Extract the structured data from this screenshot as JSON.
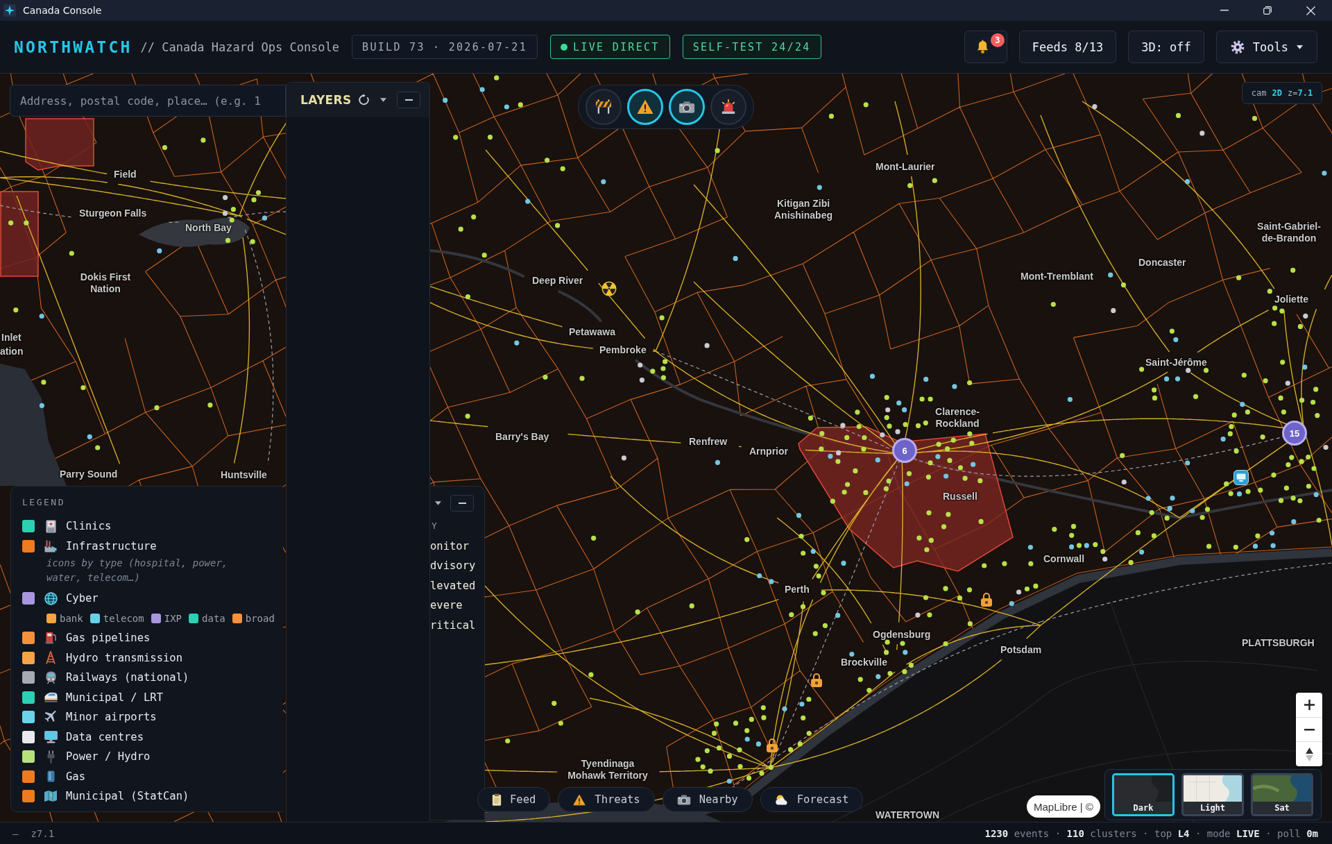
{
  "window": {
    "title": "Canada Console"
  },
  "header": {
    "brand": "NORTHWATCH",
    "subtitle": "// Canada Hazard Ops Console",
    "build": "BUILD 73 · 2026-07-21",
    "status_chips": [
      {
        "kind": "live",
        "label": "LIVE DIRECT"
      },
      {
        "kind": "test",
        "label": "SELF-TEST 24/24"
      }
    ],
    "notifications": {
      "badge": "3"
    },
    "buttons": [
      {
        "kind": "feeds",
        "label": "Feeds 8/13"
      },
      {
        "kind": "view",
        "label": "3D: off"
      },
      {
        "kind": "menu",
        "label": "Tools"
      }
    ]
  },
  "search": {
    "placeholder": "Address, postal code, place… (e.g. 1"
  },
  "layers_panel": {
    "title": "LAYERS"
  },
  "map_toolbar": [
    {
      "kind": "roadwork",
      "selected": false
    },
    {
      "kind": "hazard",
      "selected": true
    },
    {
      "kind": "camera",
      "selected": true
    },
    {
      "kind": "alert",
      "selected": false
    }
  ],
  "camera_status": {
    "label": "cam",
    "mode": "2D",
    "zoom_prefix": "z=",
    "zoom": "7.1"
  },
  "map": {
    "place_labels": [
      "Field",
      "Sturgeon Falls",
      "North Bay",
      "Dokis First Nation",
      "Inlet",
      "ation",
      "Parry Sound",
      "Huntsville",
      "Deep River",
      "Petawawa",
      "Pembroke",
      "Barry's Bay",
      "Renfrew",
      "Arnprior",
      "Mont-Laurier",
      "Kitigan Zibi Anishinabeg",
      "Saint-Gabriel-de-Brandon",
      "Doncaster",
      "Mont-Tremblant",
      "Joliette",
      "Saint-Jérôme",
      "Clarence-Rockland",
      "Russell",
      "Cornwall",
      "Perth",
      "Ogdensburg",
      "Brockville",
      "Potsdam",
      "PLATTSBURGH",
      "Tyendinaga Mohawk Territory",
      "WATERTOWN"
    ],
    "clusters": [
      {
        "count": "6"
      },
      {
        "count": "15"
      }
    ]
  },
  "legend": {
    "title": "LEGEND",
    "items": [
      {
        "kind": "layer",
        "label": "Clinics",
        "color": "#2ccfb1"
      },
      {
        "kind": "layer",
        "label": "Infrastructure",
        "color": "#f07a1e"
      },
      {
        "kind": "note",
        "text": "icons by type (hospital, power, water, telecom…)"
      },
      {
        "kind": "layer",
        "label": "Cyber",
        "color": "#a897df"
      },
      {
        "kind": "chips",
        "chips": [
          {
            "label": "bank",
            "color": "#f5a43f"
          },
          {
            "label": "telecom",
            "color": "#69d0ea"
          },
          {
            "label": "IXP",
            "color": "#a897df"
          },
          {
            "label": "data",
            "color": "#2ccfb1"
          },
          {
            "label": "broad",
            "color": "#f5913c"
          }
        ]
      },
      {
        "kind": "layer",
        "label": "Gas pipelines",
        "color": "#f5913c"
      },
      {
        "kind": "layer",
        "label": "Hydro transmission",
        "color": "#f7a34a"
      },
      {
        "kind": "layer",
        "label": "Railways (national)",
        "color": "#a5abb5"
      },
      {
        "kind": "layer",
        "label": "Municipal / LRT",
        "color": "#2ccfb1"
      },
      {
        "kind": "layer",
        "label": "Minor airports",
        "color": "#6ad3ea"
      },
      {
        "kind": "layer",
        "label": "Data centres",
        "color": "#e8eaee"
      },
      {
        "kind": "layer",
        "label": "Power / Hydro",
        "color": "#b7e07a"
      },
      {
        "kind": "layer",
        "label": "Gas",
        "color": "#f07a1e"
      },
      {
        "kind": "layer",
        "label": "Municipal (StatCan)",
        "color": "#f07a1e"
      }
    ]
  },
  "severity_panel": {
    "heading": "Y",
    "levels": [
      "onitor",
      "dvisory",
      "levated",
      "evere",
      "ritical"
    ]
  },
  "bottom_tabs": [
    {
      "kind": "feed",
      "label": "Feed"
    },
    {
      "kind": "threats",
      "label": "Threats"
    },
    {
      "kind": "nearby",
      "label": "Nearby"
    },
    {
      "kind": "forecast",
      "label": "Forecast"
    }
  ],
  "attribution": "MapLibre | ©",
  "basemaps": [
    {
      "kind": "dark",
      "label": "Dark",
      "selected": true
    },
    {
      "kind": "light",
      "label": "Light",
      "selected": false
    },
    {
      "kind": "satellite",
      "label": "Sat",
      "selected": false
    }
  ],
  "status_bar": {
    "left_mark": "–",
    "zoom": "z7.1",
    "summary": "**1230** events · **110** clusters · top **L4** · mode **LIVE** · poll **0m**"
  }
}
